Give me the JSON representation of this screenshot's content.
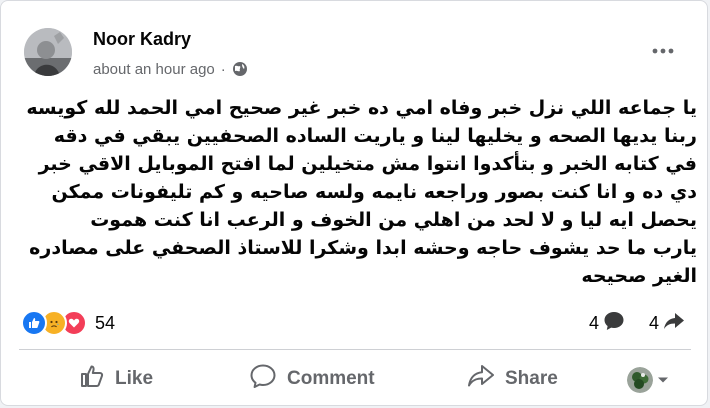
{
  "post": {
    "author": "Noor Kadry",
    "time": "about an hour ago",
    "separator": "·",
    "privacy_icon": "globe-icon",
    "paragraphs": [
      "يا جماعه اللي نزل خبر وفاه امي ده خبر غير صحيح امي الحمد لله كويسه ربنا يديها الصحه و يخليها لينا و ياريت الساده الصحفيين يبقي في دقه في كتابه الخبر و بتأكدوا انتوا مش متخيلين لما افتح الموبايل الاقي خبر دي ده و انا كنت بصور وراجعه نايمه ولسه صاحيه و كم تليفونات ممكن يحصل ايه ليا و لا لحد من اهلي من الخوف و الرعب انا كنت هموت",
      "يارب ما حد يشوف حاجه وحشه ابدا وشكرا للاستاذ الصحفي على مصادره الغير صحيحه"
    ]
  },
  "stats": {
    "reaction_count": "54",
    "comment_count": "4",
    "share_count": "4",
    "reaction_icons": [
      "like-reaction-icon",
      "sad-reaction-icon",
      "love-reaction-icon"
    ]
  },
  "actions": {
    "like": "Like",
    "comment": "Comment",
    "share": "Share"
  },
  "colors": {
    "like_blue": "#1877f2",
    "love_red": "#f33e58",
    "sad_yellow": "#f7b125",
    "secondary_text": "#65676b"
  }
}
